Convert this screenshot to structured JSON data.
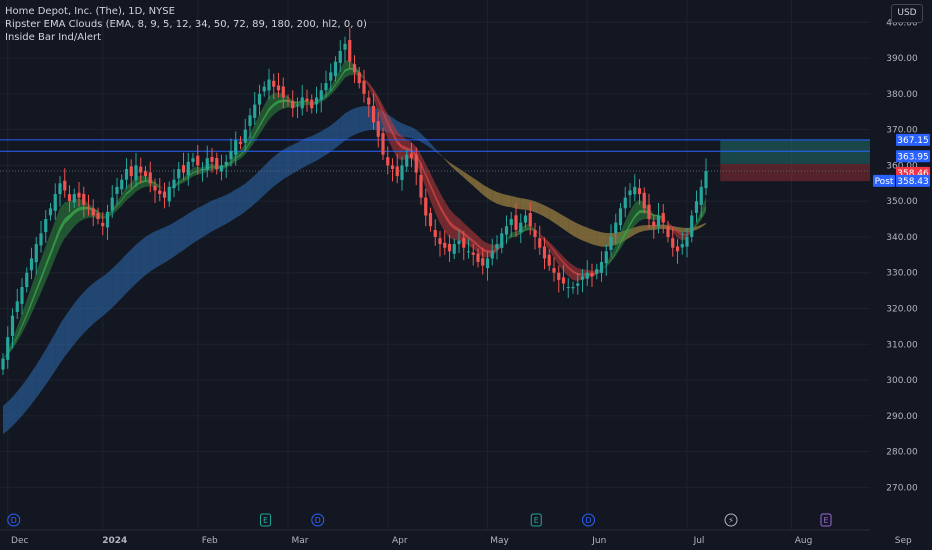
{
  "legend": {
    "symbol_line": "Home Depot, Inc. (The), 1D, NYSE",
    "indicator1": "Ripster EMA Clouds (EMA, 8, 9, 5, 12, 34, 50, 72, 89, 180, 200, hl2, 0, 0)",
    "indicator2": "Inside Bar Ind/Alert"
  },
  "currency": "USD",
  "chart_data": {
    "type": "candlestick",
    "y_axis": {
      "min": 262,
      "max": 404,
      "ticks": [
        270,
        280,
        290,
        300,
        310,
        320,
        330,
        340,
        350,
        360,
        370,
        380,
        390,
        400
      ],
      "tick_labels": [
        "270.00",
        "280.00",
        "290.00",
        "300.00",
        "310.00",
        "320.00",
        "330.00",
        "340.00",
        "350.00",
        "360.00",
        "370.00",
        "380.00",
        "390.00",
        "400.00"
      ]
    },
    "x_axis": {
      "labels": [
        "Dec",
        "2024",
        "Feb",
        "Mar",
        "Apr",
        "May",
        "Jun",
        "Jul",
        "Aug",
        "Sep"
      ],
      "label_index": [
        1,
        21,
        41,
        60,
        81,
        102,
        123,
        144,
        166,
        187
      ]
    },
    "price_labels": [
      {
        "text": "367.15",
        "value": 367.15,
        "color": "#2962ff"
      },
      {
        "text": "363.95",
        "value": 363.95,
        "color": "#2962ff"
      },
      {
        "text": "358.46",
        "value": 358.46,
        "color": "#f23645"
      },
      {
        "text": "Post",
        "value": 356.5,
        "color": "#2962ff"
      },
      {
        "text": "358.43",
        "value": 356.5,
        "color": "#2962ff"
      }
    ],
    "horizontal_lines": [
      367.15,
      363.95
    ],
    "position_tool": {
      "start_index": 151,
      "end_index": 191,
      "entry": 360.4,
      "target": 367.15,
      "stop": 355.6
    },
    "event_markers": [
      {
        "index": 1,
        "letter": "D",
        "kind": "dividend"
      },
      {
        "index": 54,
        "letter": "E",
        "kind": "earnings"
      },
      {
        "index": 65,
        "letter": "D",
        "kind": "dividend"
      },
      {
        "index": 111,
        "letter": "E",
        "kind": "earnings"
      },
      {
        "index": 122,
        "letter": "D",
        "kind": "dividend"
      },
      {
        "index": 152,
        "letter": "⚡",
        "kind": "split"
      },
      {
        "index": 172,
        "letter": "E",
        "kind": "earnings"
      }
    ],
    "closes": [
      306,
      312,
      318,
      322,
      326,
      330,
      334,
      338,
      341,
      345,
      348,
      352,
      355,
      353,
      350,
      352,
      351,
      349,
      348,
      346,
      345,
      343,
      347,
      351,
      354,
      356,
      359,
      357,
      360,
      358,
      357,
      355,
      353,
      352,
      351,
      354,
      356,
      359,
      358,
      361,
      362,
      360,
      359,
      362,
      361,
      359,
      360,
      361,
      364,
      367,
      366,
      370,
      374,
      377,
      380,
      382,
      384,
      382,
      381,
      379,
      378,
      376,
      377,
      379,
      378,
      376,
      379,
      381,
      383,
      386,
      389,
      392,
      394,
      389,
      386,
      383,
      380,
      377,
      372,
      368,
      363,
      360,
      359,
      357,
      360,
      363,
      362,
      358,
      351,
      346,
      343,
      340,
      338,
      337,
      336,
      338,
      339,
      337,
      336,
      335,
      333,
      332,
      334,
      336,
      338,
      341,
      343,
      345,
      342,
      344,
      346,
      343,
      340,
      337,
      334,
      332,
      330,
      328,
      327,
      326,
      326,
      327,
      329,
      330,
      329,
      331,
      333,
      336,
      340,
      344,
      348,
      351,
      353,
      354,
      352,
      348,
      345,
      343,
      346,
      344,
      340,
      337,
      336,
      338,
      340,
      346,
      350,
      354,
      358.43
    ]
  }
}
